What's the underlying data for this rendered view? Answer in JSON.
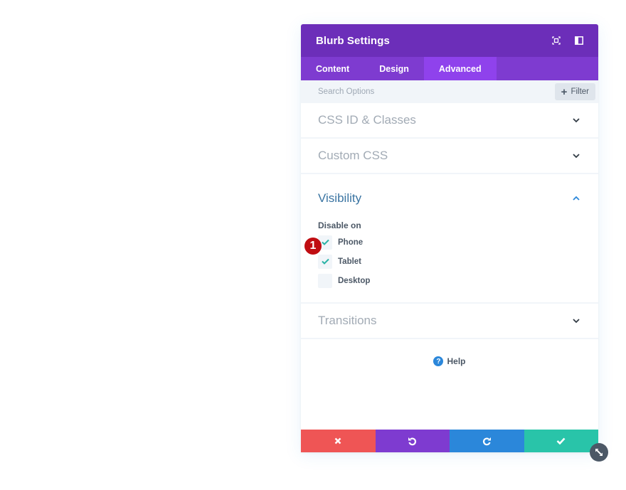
{
  "modal": {
    "title": "Blurb Settings",
    "header_icons": [
      "expand-icon",
      "sidebar-toggle-icon"
    ],
    "tabs": [
      {
        "label": "Content",
        "active": false
      },
      {
        "label": "Design",
        "active": false
      },
      {
        "label": "Advanced",
        "active": true
      }
    ],
    "search": {
      "placeholder": "Search Options",
      "value": ""
    },
    "filter_label": "Filter",
    "sections": {
      "css_id": {
        "title": "CSS ID & Classes",
        "expanded": false
      },
      "custom_css": {
        "title": "Custom CSS",
        "expanded": false
      },
      "visibility": {
        "title": "Visibility",
        "expanded": true,
        "disable_on_label": "Disable on",
        "options": [
          {
            "label": "Phone",
            "checked": true
          },
          {
            "label": "Tablet",
            "checked": true
          },
          {
            "label": "Desktop",
            "checked": false
          }
        ]
      },
      "transitions": {
        "title": "Transitions",
        "expanded": false
      }
    },
    "help_label": "Help",
    "footer_buttons": [
      "cancel",
      "undo",
      "redo",
      "save"
    ]
  },
  "annotation": {
    "badge_number": "1"
  },
  "colors": {
    "header": "#6c2eb9",
    "tabs": "#7e3bd0",
    "active_tab": "#8f42ec",
    "cancel": "#ef5555",
    "undo": "#7e3bd0",
    "redo": "#2b87da",
    "save": "#29c4a9",
    "check": "#2ab3a6",
    "badge": "#c00d12"
  }
}
